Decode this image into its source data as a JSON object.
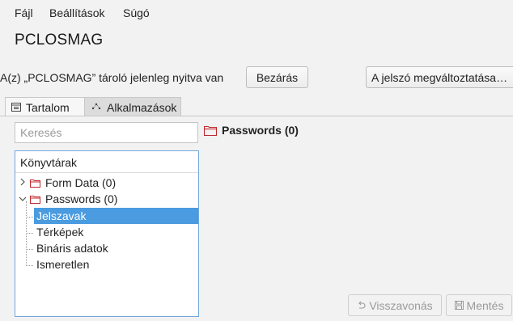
{
  "menu": {
    "file": "Fájl",
    "settings": "Beállítások",
    "help": "Súgó"
  },
  "app": {
    "title": "PCLOSMAG"
  },
  "status": {
    "text": "A(z) „PCLOSMAG” tároló jelenleg nyitva van",
    "close_button": "Bezárás",
    "change_password_button": "A jelszó megváltoztatása…"
  },
  "tabs": [
    {
      "label": "Tartalom",
      "icon": "contents-icon",
      "active": true
    },
    {
      "label": "Alkalmazások",
      "icon": "applications-icon",
      "active": false
    }
  ],
  "search": {
    "placeholder": "Keresés",
    "value": ""
  },
  "tree": {
    "header": "Könyvtárak",
    "items": [
      {
        "label": "Form Data (0)",
        "expanded": false,
        "icon": "folder-icon"
      },
      {
        "label": "Passwords (0)",
        "expanded": true,
        "icon": "folder-icon",
        "children": [
          {
            "label": "Jelszavak",
            "selected": true
          },
          {
            "label": "Térképek",
            "selected": false
          },
          {
            "label": "Bináris adatok",
            "selected": false
          },
          {
            "label": "Ismeretlen",
            "selected": false
          }
        ]
      }
    ]
  },
  "detail": {
    "title": "Passwords (0)",
    "icon": "folder-icon"
  },
  "actions": {
    "undo": "Visszavonás",
    "save": "Mentés"
  },
  "colors": {
    "folder": "#c0282d",
    "selection": "#4a9bdf",
    "tree_border": "#6fa8dc",
    "background": "#f2f2f2"
  }
}
